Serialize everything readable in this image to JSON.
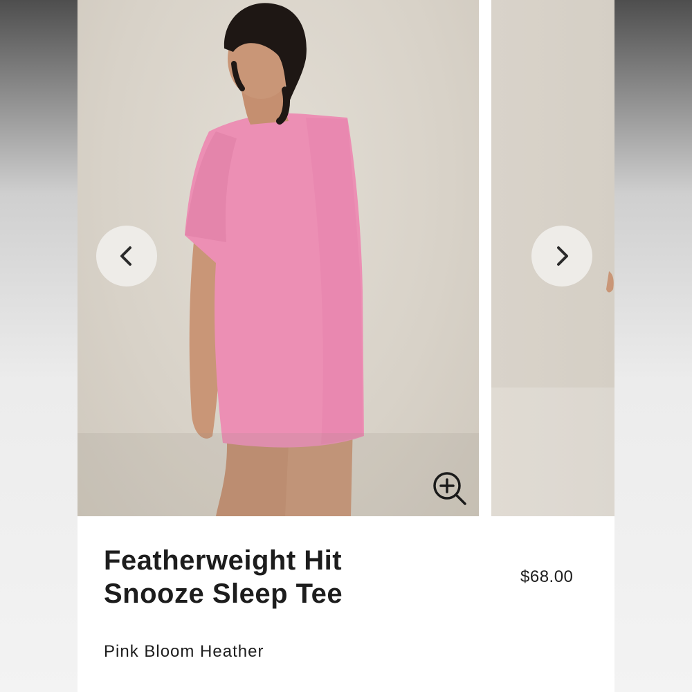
{
  "carousel": {
    "prev_icon": "chevron-left-icon",
    "next_icon": "chevron-right-icon",
    "zoom_icon": "zoom-in-icon"
  },
  "product": {
    "title": "Featherweight Hit Snooze Sleep Tee",
    "price": "$68.00",
    "color_name": "Pink Bloom Heather"
  },
  "colors": {
    "tee_pink": "#ec8fb4",
    "background_beige": "#d8d2c8",
    "text": "#1d1d1d"
  }
}
